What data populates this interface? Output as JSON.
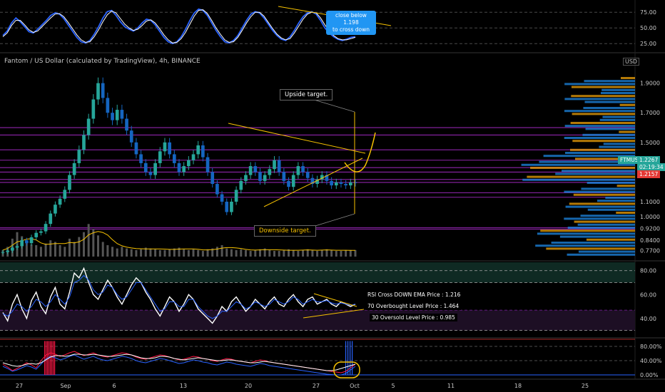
{
  "chart_data": [
    {
      "type": "line",
      "panel": "upper-oscillator",
      "y_ticks": [
        "75.00",
        "50.00",
        "25.00"
      ],
      "ylim": [
        15,
        90
      ],
      "series": [
        {
          "color": "#2962ff",
          "values": [
            38,
            45,
            58,
            66,
            60,
            52,
            44,
            42,
            48,
            55,
            62,
            70,
            74,
            72,
            65,
            55,
            45,
            35,
            28,
            26,
            30,
            40,
            52,
            66,
            76,
            78,
            70,
            60,
            52,
            48,
            45,
            50,
            58,
            64,
            62,
            55,
            45,
            35,
            28,
            25,
            28,
            36,
            48,
            62,
            74,
            80,
            78,
            70,
            58,
            46,
            36,
            28,
            26,
            30,
            38,
            50,
            62,
            72,
            76,
            74,
            66,
            56,
            46,
            38,
            32,
            30,
            36,
            46,
            58,
            68,
            74,
            76,
            72,
            62,
            50,
            42,
            36,
            32,
            30,
            32,
            35,
            36
          ]
        },
        {
          "color": "#ffffff",
          "values": [
            36,
            42,
            54,
            62,
            62,
            55,
            47,
            43,
            45,
            52,
            59,
            66,
            72,
            73,
            68,
            59,
            49,
            39,
            31,
            27,
            28,
            36,
            47,
            60,
            71,
            77,
            74,
            65,
            56,
            50,
            46,
            48,
            54,
            61,
            63,
            58,
            49,
            39,
            31,
            26,
            27,
            33,
            43,
            56,
            69,
            78,
            79,
            73,
            62,
            50,
            40,
            31,
            27,
            28,
            35,
            46,
            58,
            68,
            75,
            75,
            69,
            59,
            49,
            40,
            34,
            31,
            33,
            42,
            53,
            64,
            72,
            75,
            74,
            66,
            55,
            45,
            38,
            33,
            31,
            31,
            33,
            35
          ]
        }
      ],
      "annotations": [
        {
          "text": "close below 1.198\nto cross down"
        }
      ]
    },
    {
      "type": "line",
      "panel": "price",
      "title": "Fantom / US Dollar (calculated by TradingView), 4h, BINANCE",
      "currency": "USD",
      "y_ticks": [
        "1.9000",
        "1.7000",
        "1.5000",
        "1.3000",
        "1.1000",
        "1.0000",
        "0.9200",
        "0.8400",
        "0.7700"
      ],
      "ylim": [
        0.72,
        1.98
      ],
      "horizontal_levels": [
        1.6,
        1.55,
        1.45,
        1.38,
        1.33,
        1.3,
        1.25,
        1.23,
        1.16,
        1.13,
        0.925,
        0.915
      ],
      "series": [
        {
          "name": "FTMUSD",
          "color": "#26a69a",
          "values": [
            0.76,
            0.77,
            0.79,
            0.8,
            0.84,
            0.82,
            0.86,
            0.89,
            0.9,
            0.95,
            1.02,
            1.08,
            1.12,
            1.18,
            1.28,
            1.36,
            1.45,
            1.55,
            1.66,
            1.79,
            1.9,
            1.8,
            1.7,
            1.65,
            1.72,
            1.66,
            1.58,
            1.5,
            1.42,
            1.36,
            1.3,
            1.28,
            1.36,
            1.44,
            1.5,
            1.42,
            1.36,
            1.3,
            1.34,
            1.38,
            1.42,
            1.48,
            1.4,
            1.3,
            1.22,
            1.15,
            1.1,
            1.03,
            1.1,
            1.18,
            1.24,
            1.28,
            1.34,
            1.3,
            1.24,
            1.28,
            1.32,
            1.38,
            1.3,
            1.24,
            1.2,
            1.28,
            1.34,
            1.3,
            1.26,
            1.22,
            1.25,
            1.28,
            1.24,
            1.21,
            1.23,
            1.22,
            1.21,
            1.23,
            1.2267
          ]
        }
      ],
      "last_price": {
        "label": "FTMUSD",
        "value": "1.2267",
        "countdown": "02:19:34"
      },
      "level_tag": {
        "value": "1.2157"
      },
      "volume": [
        8,
        12,
        22,
        30,
        25,
        18,
        15,
        14,
        12,
        16,
        20,
        18,
        14,
        12,
        22,
        18,
        24,
        30,
        40,
        34,
        26,
        18,
        14,
        12,
        10,
        12,
        10,
        9,
        8,
        9,
        11,
        10,
        9,
        8,
        8,
        9,
        10,
        11,
        9,
        8,
        9,
        8,
        7,
        9,
        10,
        12,
        14,
        10,
        9,
        8,
        9,
        8,
        7,
        8,
        9,
        10,
        8,
        7,
        7,
        8,
        9,
        8,
        7,
        8,
        9,
        8,
        7,
        8,
        9,
        8,
        7,
        7,
        8,
        8,
        8
      ],
      "annotations": [
        {
          "text": "Upside target."
        },
        {
          "text": "Downside target."
        }
      ],
      "x_ticks": [
        "27",
        "Sep",
        "6",
        "13",
        "20",
        "27",
        "Oct",
        "5",
        "11",
        "18",
        "25"
      ]
    },
    {
      "type": "line",
      "panel": "rsi",
      "y_ticks": [
        "80.00",
        "60.00",
        "40.00"
      ],
      "ylim": [
        25,
        87
      ],
      "overbought": 70,
      "oversold": 30,
      "series": [
        {
          "color": "#ffffff",
          "values": [
            45,
            38,
            52,
            60,
            48,
            40,
            55,
            62,
            50,
            44,
            58,
            66,
            52,
            48,
            62,
            78,
            74,
            82,
            70,
            60,
            56,
            64,
            72,
            66,
            58,
            52,
            60,
            68,
            74,
            70,
            62,
            56,
            48,
            42,
            50,
            58,
            54,
            46,
            52,
            60,
            56,
            48,
            44,
            40,
            36,
            42,
            50,
            46,
            54,
            58,
            52,
            46,
            50,
            56,
            52,
            48,
            54,
            58,
            52,
            50,
            56,
            60,
            54,
            50,
            56,
            58,
            52,
            54,
            56,
            52,
            50,
            54,
            52,
            50,
            52
          ]
        },
        {
          "color": "#2962ff",
          "values": [
            44,
            42,
            46,
            52,
            50,
            46,
            50,
            56,
            54,
            50,
            54,
            60,
            56,
            52,
            58,
            70,
            72,
            76,
            72,
            64,
            60,
            62,
            68,
            66,
            60,
            56,
            58,
            64,
            70,
            70,
            64,
            58,
            52,
            46,
            48,
            54,
            54,
            50,
            50,
            56,
            56,
            50,
            46,
            42,
            40,
            42,
            46,
            46,
            50,
            54,
            52,
            48,
            50,
            54,
            52,
            50,
            52,
            56,
            54,
            52,
            54,
            58,
            56,
            52,
            54,
            56,
            54,
            54,
            55,
            53,
            52,
            53,
            52,
            51,
            52
          ]
        }
      ],
      "annotations": [
        {
          "text": "RSI Cross DOWN EMA Price : 1.216"
        },
        {
          "text": "70 Overbought Level Price : 1.464"
        },
        {
          "text": "30 Oversold Level Price : 0.985"
        }
      ]
    },
    {
      "type": "line",
      "panel": "lower-oscillator",
      "y_ticks": [
        "80.00%",
        "40.00%",
        "0.00%"
      ],
      "ylim": [
        -8,
        100
      ],
      "series": [
        {
          "color": "#ff1744",
          "values": [
            30,
            22,
            12,
            18,
            26,
            34,
            28,
            20,
            40,
            55,
            62,
            58,
            52,
            56,
            62,
            66,
            60,
            54,
            58,
            62,
            56,
            52,
            50,
            54,
            58,
            62,
            60,
            56,
            50,
            46,
            44,
            48,
            52,
            56,
            54,
            50,
            46,
            42,
            44,
            48,
            52,
            50,
            46,
            44,
            40,
            38,
            42,
            46,
            44,
            40,
            38,
            36,
            34,
            38,
            42,
            40,
            36,
            34,
            32,
            30,
            28,
            26,
            24,
            22,
            20,
            18,
            16,
            14,
            12,
            10,
            8,
            6,
            10,
            20,
            30
          ]
        },
        {
          "color": "#2962ff",
          "values": [
            24,
            18,
            10,
            14,
            20,
            26,
            22,
            16,
            30,
            44,
            52,
            48,
            42,
            46,
            52,
            56,
            50,
            44,
            48,
            52,
            46,
            42,
            40,
            44,
            48,
            52,
            50,
            46,
            40,
            36,
            34,
            38,
            42,
            46,
            44,
            40,
            36,
            32,
            34,
            38,
            42,
            40,
            36,
            34,
            30,
            28,
            32,
            36,
            34,
            30,
            28,
            26,
            24,
            28,
            32,
            30,
            26,
            24,
            22,
            20,
            18,
            16,
            14,
            12,
            10,
            8,
            6,
            4,
            2,
            1,
            0,
            0,
            4,
            14,
            24
          ]
        },
        {
          "color": "#ffffff",
          "values": [
            34,
            30,
            26,
            24,
            26,
            30,
            32,
            30,
            34,
            42,
            50,
            54,
            54,
            52,
            54,
            58,
            58,
            56,
            56,
            58,
            56,
            54,
            52,
            52,
            54,
            56,
            58,
            56,
            52,
            48,
            46,
            46,
            48,
            52,
            52,
            50,
            46,
            44,
            42,
            44,
            46,
            48,
            46,
            44,
            42,
            40,
            40,
            42,
            42,
            40,
            38,
            36,
            34,
            34,
            36,
            38,
            36,
            34,
            32,
            30,
            28,
            26,
            24,
            22,
            20,
            18,
            16,
            14,
            12,
            12,
            14,
            18,
            22,
            26,
            30
          ]
        }
      ]
    }
  ]
}
